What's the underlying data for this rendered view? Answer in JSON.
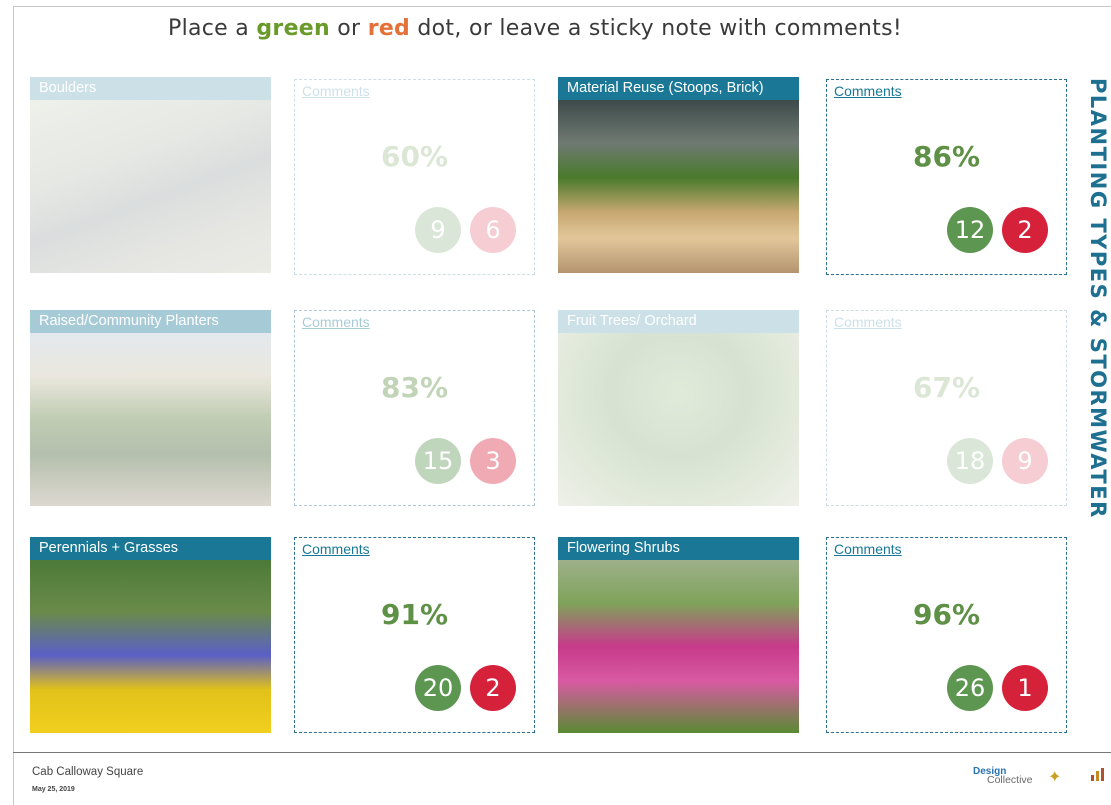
{
  "header": {
    "text_before_green": "Place a ",
    "green_word": "green",
    "text_between": " or ",
    "red_word": "red",
    "text_after_red": " dot, or leave a sticky note with comments!"
  },
  "section_title": "PLANTING TYPES & STORMWATER",
  "comments_label": "Comments",
  "colors": {
    "accent": "#1a7896",
    "green_dot": "#5d9650",
    "red_dot": "#d6213b",
    "percent": "#5e9045"
  },
  "items": [
    {
      "title": "Boulders",
      "percent": "60%",
      "green": "9",
      "red": "6",
      "state": "faded"
    },
    {
      "title": "Material Reuse (Stoops, Brick)",
      "percent": "86%",
      "green": "12",
      "red": "2",
      "state": "active"
    },
    {
      "title": "Raised/Community Planters",
      "percent": "83%",
      "green": "15",
      "red": "3",
      "state": "partial"
    },
    {
      "title": "Fruit Trees/ Orchard",
      "percent": "67%",
      "green": "18",
      "red": "9",
      "state": "faded"
    },
    {
      "title": "Perennials + Grasses",
      "percent": "91%",
      "green": "20",
      "red": "2",
      "state": "active"
    },
    {
      "title": "Flowering Shrubs",
      "percent": "96%",
      "green": "26",
      "red": "1",
      "state": "active"
    }
  ],
  "footer": {
    "site": "Cab Calloway Square",
    "date": "May 25, 2019",
    "logo_design": "Design",
    "logo_collective": "Collective"
  }
}
